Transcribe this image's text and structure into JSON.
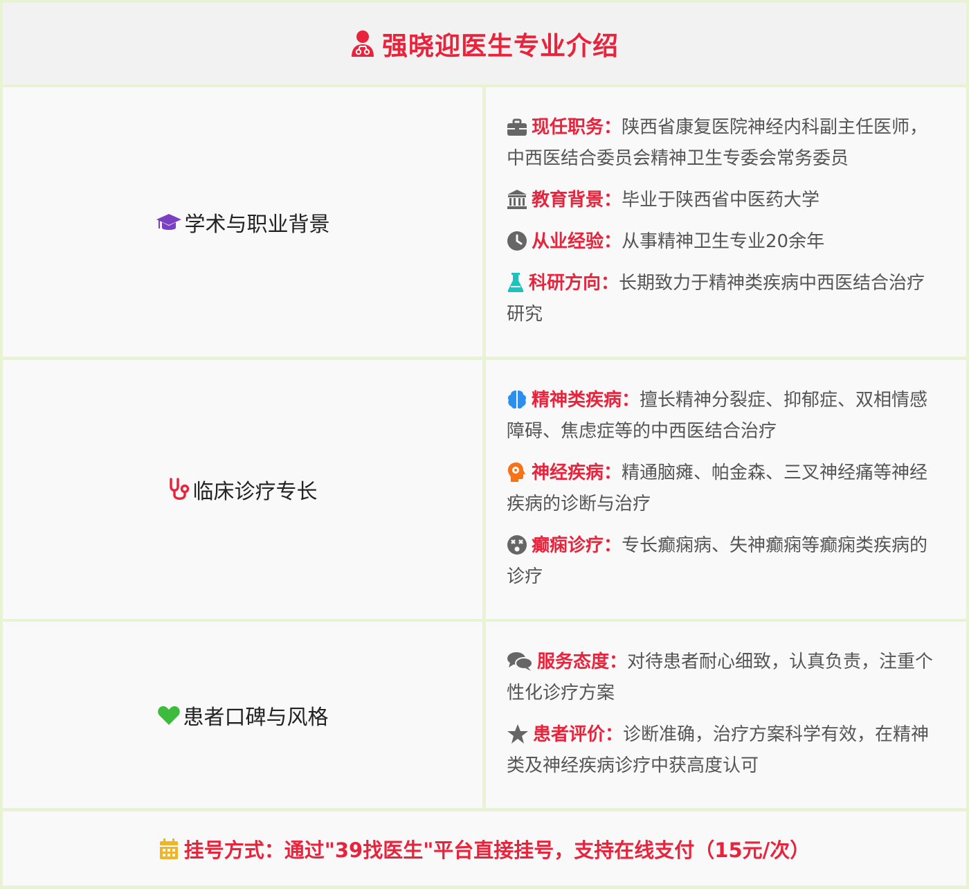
{
  "header": {
    "title": "强晓迎医生专业介绍",
    "icon": "doctor-icon",
    "accent_color": "#e8243c"
  },
  "sections": [
    {
      "label": "学术与职业背景",
      "icon": "graduation-cap-icon",
      "icon_color": "#7b3fc4",
      "items": [
        {
          "icon": "briefcase-icon",
          "label": "现任职务：",
          "text": "陕西省康复医院神经内科副主任医师，中西医结合委员会精神卫生专委会常务委员"
        },
        {
          "icon": "university-icon",
          "label": "教育背景：",
          "text": "毕业于陕西省中医药大学"
        },
        {
          "icon": "clock-icon",
          "label": "从业经验：",
          "text": "从事精神卫生专业20余年"
        },
        {
          "icon": "flask-icon",
          "label": "科研方向：",
          "text": "长期致力于精神类疾病中西医结合治疗研究"
        }
      ]
    },
    {
      "label": "临床诊疗专长",
      "icon": "stethoscope-icon",
      "icon_color": "#e8243c",
      "items": [
        {
          "icon": "brain-icon",
          "label": "精神类疾病：",
          "text": "擅长精神分裂症、抑郁症、双相情感障碍、焦虑症等的中西医结合治疗"
        },
        {
          "icon": "head-gear-icon",
          "label": "神经疾病：",
          "text": "精通脑瘫、帕金森、三叉神经痛等神经疾病的诊断与治疗"
        },
        {
          "icon": "dizzy-face-icon",
          "label": "癫痫诊疗：",
          "text": "专长癫痫病、失神癫痫等癫痫类疾病的诊疗"
        }
      ]
    },
    {
      "label": "患者口碑与风格",
      "icon": "heart-icon",
      "icon_color": "#3dbb3d",
      "items": [
        {
          "icon": "comments-icon",
          "label": "服务态度：",
          "text": "对待患者耐心细致，认真负责，注重个性化诊疗方案"
        },
        {
          "icon": "star-icon",
          "label": "患者评价：",
          "text": "诊断准确，治疗方案科学有效，在精神类及神经疾病诊疗中获高度认可"
        }
      ]
    }
  ],
  "footer": {
    "text": "挂号方式：通过\"39找医生\"平台直接挂号，支持在线支付（15元/次）",
    "icon": "calendar-icon",
    "icon_color": "#f0b429"
  }
}
